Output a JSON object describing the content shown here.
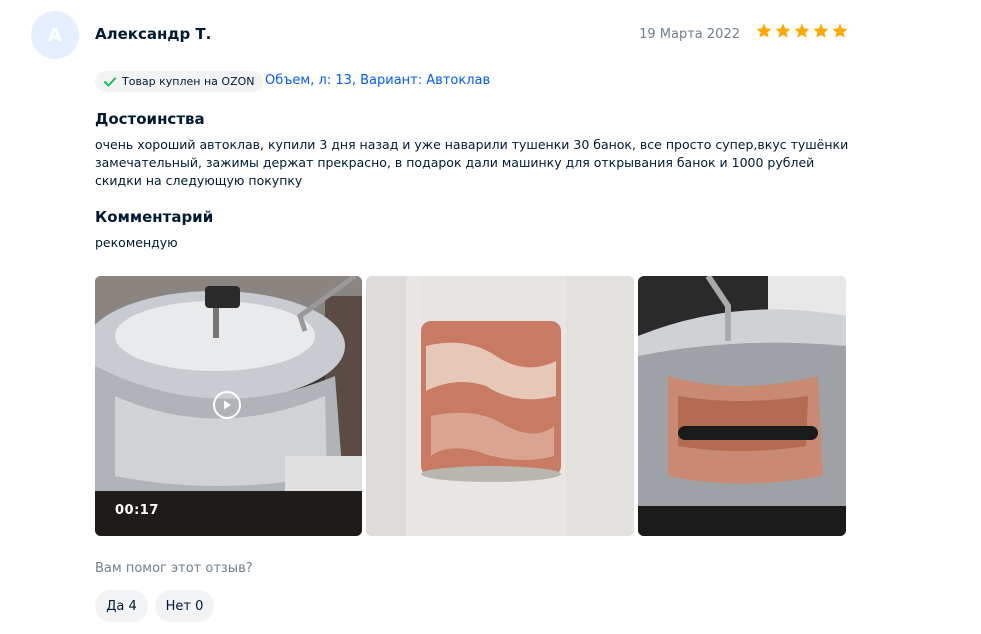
{
  "review": {
    "avatar_letter": "А",
    "author": "Александр Т.",
    "date": "19 Марта 2022",
    "rating": 5,
    "rating_max": 5,
    "badge": "Товар куплен на OZON",
    "variant": "Объем, л: 13, Вариант: Автоклав",
    "pros_title": "Достоинства",
    "pros_text": "очень хороший автоклав, купили 3 дня назад и уже наварили тушенки 30 банок, все просто супер,вкус тушёнки замечательный, зажимы держат прекрасно, в подарок дали машинку для открывания банок и 1000 рублей скидки на следующую покупку",
    "comment_title": "Комментарий",
    "comment_text": "рекомендую",
    "video_duration": "00:17",
    "helpful_question": "Вам помог этот отзыв?",
    "yes_label": "Да 4",
    "no_label": "Нет 0"
  },
  "colors": {
    "accent": "#005bff",
    "star": "#ffa800",
    "check": "#10c44c",
    "muted": "#707f8d"
  }
}
